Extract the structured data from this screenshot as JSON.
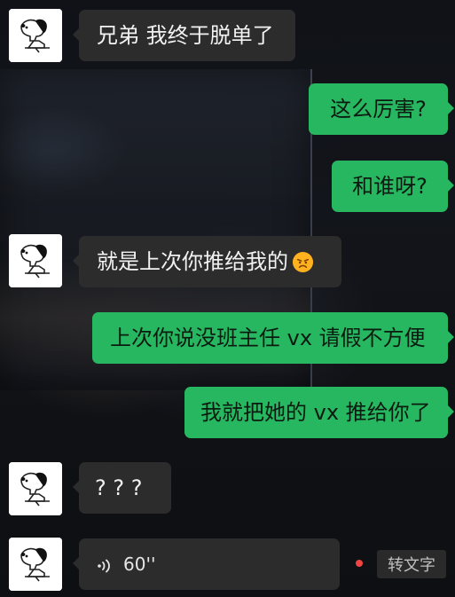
{
  "chat": {
    "messages": [
      {
        "id": "m1",
        "side": "left",
        "text": "兄弟 我终于脱单了"
      },
      {
        "id": "m2",
        "side": "right",
        "text": "这么厉害?"
      },
      {
        "id": "m3",
        "side": "right",
        "text": "和谁呀?"
      },
      {
        "id": "m4",
        "side": "left",
        "text": "就是上次你推给我的",
        "emoji": "annoyed-face-emoji"
      },
      {
        "id": "m5",
        "side": "right",
        "text": "上次你说没班主任 vx 请假不方便"
      },
      {
        "id": "m6",
        "side": "right",
        "text": "我就把她的 vx 推给你了"
      },
      {
        "id": "m7",
        "side": "left",
        "text": "? ? ?"
      }
    ],
    "voice": {
      "duration": "60''",
      "convert_label": "转文字",
      "icon": "voice-wave-icon",
      "unread_dot_color": "#f04444"
    }
  },
  "avatar": {
    "icon": "snoopy-avatar-icon"
  },
  "colors": {
    "incoming_bubble": "#2c2c2c",
    "outgoing_bubble": "#28b761",
    "text_light": "#f2f2f2",
    "text_dark": "#0c1b10"
  }
}
